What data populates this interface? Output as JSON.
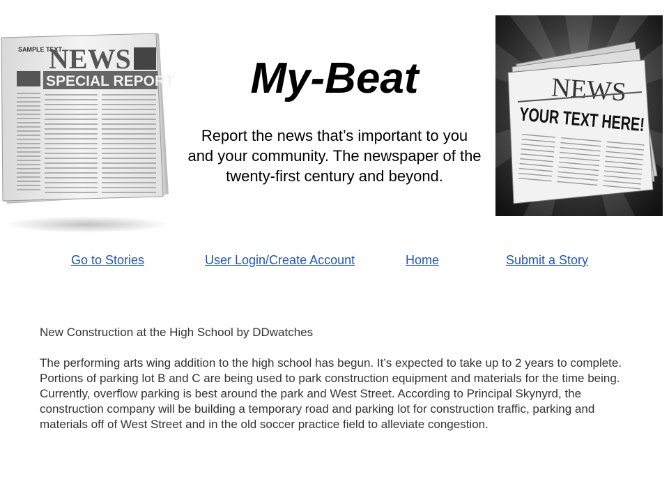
{
  "header": {
    "title": "My-Beat",
    "tagline_lines": [
      "Report the news that’s important to you",
      "and your community. The newspaper of the",
      "twenty-first century and beyond."
    ]
  },
  "images": {
    "left_paper": {
      "icon": "newspaper-special-report-icon",
      "sample_text": "SAMPLE TEXT",
      "masthead": "NEWS",
      "banner": "SPECIAL REPORT"
    },
    "right_paper": {
      "icon": "newspaper-your-text-icon",
      "masthead": "NEWS",
      "headline": "YOUR TEXT HERE!"
    }
  },
  "nav": {
    "go_to_stories": "Go to Stories",
    "login": "User Login/Create Account",
    "home": "Home",
    "submit": "Submit a Story"
  },
  "story": {
    "heading": "New Construction at the High School by DDwatches",
    "body": "The performing arts wing addition to the high school has begun. It’s expected to take up to 2 years to complete. Portions of parking lot B and C are being used to park construction equipment and materials for the time being. Currently, overflow parking is best around the park and West Street. According to Principal Skynyrd, the construction company will be building a temporary road and parking lot for construction traffic, parking and materials off of West Street and in the old soccer practice field to alleviate congestion."
  },
  "colors": {
    "link": "#1f55b7",
    "text": "#333333",
    "title": "#000000"
  }
}
